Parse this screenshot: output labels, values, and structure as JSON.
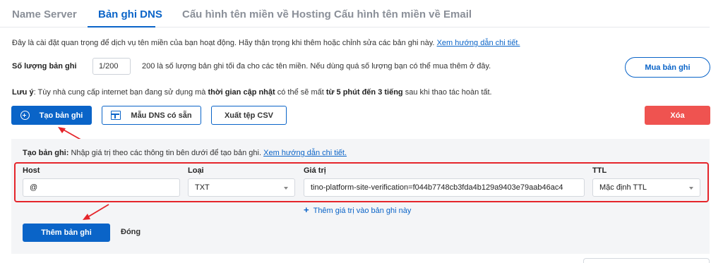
{
  "tabs": [
    {
      "label": "Name Server",
      "active": false
    },
    {
      "label": "Bản ghi DNS",
      "active": true
    },
    {
      "label": "Cấu hình tên miền về Hosting",
      "active": false
    },
    {
      "label": "Cấu hình tên miền về Email",
      "active": false
    }
  ],
  "notice": {
    "text": "Đây là cài đặt quan trọng để dịch vụ tên miền của bạn hoạt động. Hãy thận trọng khi thêm hoặc chỉnh sửa các bản ghi này.",
    "link": "Xem hướng dẫn chi tiết."
  },
  "record_count": {
    "label": "Số lượng bản ghi",
    "value": "1/200",
    "description": "200 là số lượng bản ghi tối đa cho các tên miền. Nếu dùng quá số lượng bạn có thể mua thêm ở đây.",
    "buy_button": "Mua bản ghi"
  },
  "warning": {
    "prefix": "Lưu ý",
    "part1": ": Tùy nhà cung cấp internet bạn đang sử dụng mà ",
    "bold1": "thời gian cập nhật",
    "part2": " có thể sẽ mất ",
    "bold2": "từ 5 phút đến 3 tiếng",
    "part3": " sau khi thao tác hoàn tất."
  },
  "toolbar": {
    "create": "Tạo bản ghi",
    "templates": "Mẫu DNS có sẵn",
    "export": "Xuất tệp CSV",
    "delete": "Xóa"
  },
  "create_form": {
    "intro_bold": "Tạo bản ghi:",
    "intro_text": " Nhập giá trị theo các thông tin bên dưới để tạo bản ghi.",
    "intro_link": "Xem hướng dẫn chi tiết.",
    "host_label": "Host",
    "host_value": "@",
    "type_label": "Loại",
    "type_value": "TXT",
    "value_label": "Giá trị",
    "value_value": "tino-platform-site-verification=f044b7748cb3fda4b129a9403e79aab46ac4",
    "ttl_label": "TTL",
    "ttl_value": "Mặc định TTL",
    "add_value": "Thêm giá trị vào bản ghi này",
    "submit": "Thêm bản ghi",
    "close": "Đóng"
  },
  "colors": {
    "primary": "#0a64c8",
    "danger": "#ef5350",
    "annotation": "#e5252b"
  }
}
